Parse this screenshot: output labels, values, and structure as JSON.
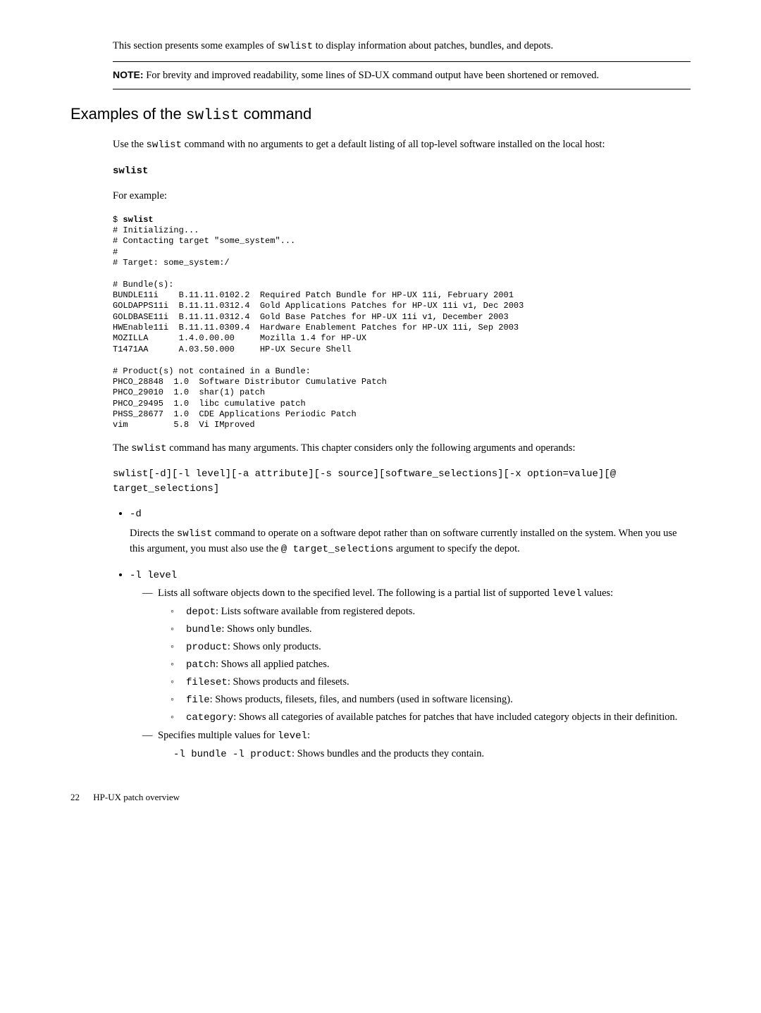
{
  "intro": "This section presents some examples of swlist to display information about patches, bundles, and depots.",
  "note": {
    "label": "NOTE:",
    "text": "For brevity and improved readability, some lines of SD-UX command output have been shortened or removed."
  },
  "heading": "Examples of the swlist command",
  "para_use": "Use the swlist command with no arguments to get a default listing of all top-level software installed on the local host:",
  "cmd_swlist": "swlist",
  "for_example": "For example:",
  "code_block": "$ swlist\n# Initializing...\n# Contacting target \"some_system\"...\n#\n# Target: some_system:/\n\n# Bundle(s):\nBUNDLE11i    B.11.11.0102.2  Required Patch Bundle for HP-UX 11i, February 2001\nGOLDAPPS11i  B.11.11.0312.4  Gold Applications Patches for HP-UX 11i v1, Dec 2003\nGOLDBASE11i  B.11.11.0312.4  Gold Base Patches for HP-UX 11i v1, December 2003\nHWEnable11i  B.11.11.0309.4  Hardware Enablement Patches for HP-UX 11i, Sep 2003\nMOZILLA      1.4.0.00.00     Mozilla 1.4 for HP-UX\nT1471AA      A.03.50.000     HP-UX Secure Shell\n\n# Product(s) not contained in a Bundle:\nPHCO_28848  1.0  Software Distributor Cumulative Patch\nPHCO_29010  1.0  shar(1) patch\nPHCO_29495  1.0  libc cumulative patch\nPHSS_28677  1.0  CDE Applications Periodic Patch\nvim         5.8  Vi IMproved",
  "para_args": "The swlist command has many arguments. This chapter considers only the following arguments and operands:",
  "synopsis": "swlist[-d][-l level][-a attribute][-s source][software_selections][-x option=value][@ target_selections]",
  "opt_d": {
    "flag": "-d",
    "desc_pre": "Directs the ",
    "desc_cmd": "swlist",
    "desc_mid": " command to operate on a software depot rather than on software currently installed on the system. When you use this argument, you must also use the ",
    "desc_at": "@ target_selections",
    "desc_post": " argument to specify the depot."
  },
  "opt_l": {
    "flag": "-l level",
    "list_intro_pre": "Lists all software objects down to the specified level. The following is a partial list of supported ",
    "list_intro_code": "level",
    "list_intro_post": " values:",
    "levels": [
      {
        "code": "depot",
        "desc": ": Lists software available from registered depots."
      },
      {
        "code": "bundle",
        "desc": ": Shows only bundles."
      },
      {
        "code": "product",
        "desc": ": Shows only products."
      },
      {
        "code": "patch",
        "desc": ": Shows all applied patches."
      },
      {
        "code": "fileset",
        "desc": ": Shows products and filesets."
      },
      {
        "code": "file",
        "desc": ": Shows products, filesets, files, and numbers (used in software licensing)."
      },
      {
        "code": "category",
        "desc": ": Shows all categories of available patches for patches that have included category objects in their definition."
      }
    ],
    "multi_intro_pre": "Specifies multiple values for ",
    "multi_intro_code": "level",
    "multi_intro_post": ":",
    "multi_example_code": "-l bundle -l product",
    "multi_example_desc": ": Shows bundles and the products they contain."
  },
  "footer": {
    "page": "22",
    "title": "HP-UX patch overview"
  }
}
